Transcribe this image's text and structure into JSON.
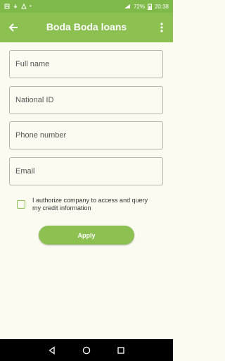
{
  "status_bar": {
    "battery": "72%",
    "time": "20:38"
  },
  "app_bar": {
    "title": "Boda Boda loans"
  },
  "form": {
    "full_name_placeholder": "Full name",
    "national_id_placeholder": "National ID",
    "phone_placeholder": "Phone number",
    "email_placeholder": "Email",
    "consent_text": "I authorize company to access and query my credit information",
    "consent_checked": false,
    "apply_label": "Apply"
  },
  "colors": {
    "primary": "#8cc152",
    "status_bar": "#7fb94a",
    "background": "#fbfbf2"
  },
  "icons": {
    "back": "arrow-left-icon",
    "menu": "more-vert-icon",
    "nav_back": "triangle-back-icon",
    "nav_home": "circle-home-icon",
    "nav_recents": "square-recents-icon"
  }
}
